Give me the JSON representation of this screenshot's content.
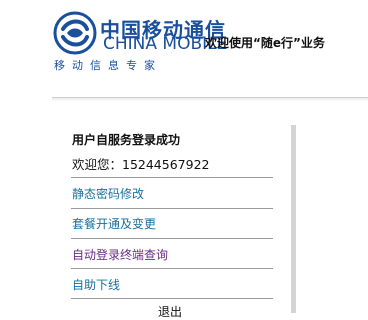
{
  "header": {
    "logo_cn": "中国移动通信",
    "logo_en": "CHINA MOBILE",
    "tagline": "欢迎使用“随e行”业务",
    "slogan": "移动信息专家"
  },
  "panel": {
    "title": "用户自服务登录成功",
    "welcome": "欢迎您：15244567922",
    "menu": [
      {
        "label": "静态密码修改"
      },
      {
        "label": "套餐开通及变更"
      },
      {
        "label": "自动登录终端查询"
      },
      {
        "label": "自助下线"
      }
    ],
    "logout_label": "退出"
  },
  "colors": {
    "brand_blue": "#1a4f9c",
    "link_blue": "#1a6fa0",
    "link_visited": "#6a2c86"
  }
}
